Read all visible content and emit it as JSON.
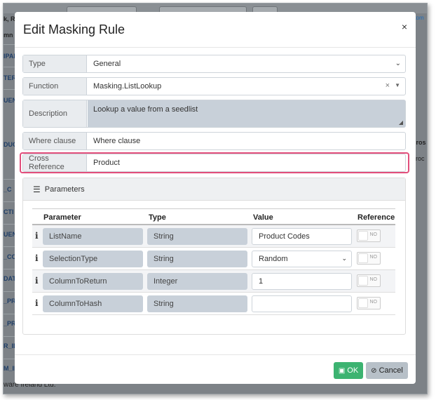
{
  "modal": {
    "title": "Edit Masking Rule",
    "close_glyph": "×"
  },
  "form": {
    "type": {
      "label": "Type",
      "value": "General"
    },
    "function": {
      "label": "Function",
      "value": "Masking.ListLookup"
    },
    "description": {
      "label": "Description",
      "value": "Lookup a value from a seedlist"
    },
    "where_clause": {
      "label": "Where clause",
      "placeholder": "Where clause"
    },
    "cross_reference": {
      "label": "Cross Reference",
      "value": "Product"
    }
  },
  "parameters": {
    "title": "Parameters",
    "columns": [
      "Parameter",
      "Type",
      "Value",
      "Reference"
    ],
    "rows": [
      {
        "info": "i",
        "name": "ListName",
        "type": "String",
        "value": "Product Codes",
        "reference": "NO"
      },
      {
        "info": "i",
        "name": "SelectionType",
        "type": "String",
        "value": "Random",
        "reference": "NO"
      },
      {
        "info": "i",
        "name": "ColumnToReturn",
        "type": "Integer",
        "value": "1",
        "reference": "NO"
      },
      {
        "info": "i",
        "name": "ColumnToHash",
        "type": "String",
        "value": "",
        "reference": "NO"
      }
    ]
  },
  "footer": {
    "ok_label": "OK",
    "cancel_label": "Cancel"
  },
  "background": {
    "left_labels": [
      "k, R",
      "mn",
      "IPAI",
      "TER",
      "UEN",
      "DUC",
      "_C",
      "CTI",
      "UEN",
      "_CO",
      "DAT",
      "_PR",
      "_PR",
      "R_ID",
      "M_ID"
    ],
    "right_labels": [
      "utom",
      "Cros",
      "Proc"
    ],
    "footer_text": "ware Ireland Ltd."
  },
  "colors": {
    "highlight": "#e24e7b",
    "ok_button": "#3cb371",
    "cancel_button": "#b7c0c8",
    "readonly_fill": "#c8d0d9"
  }
}
